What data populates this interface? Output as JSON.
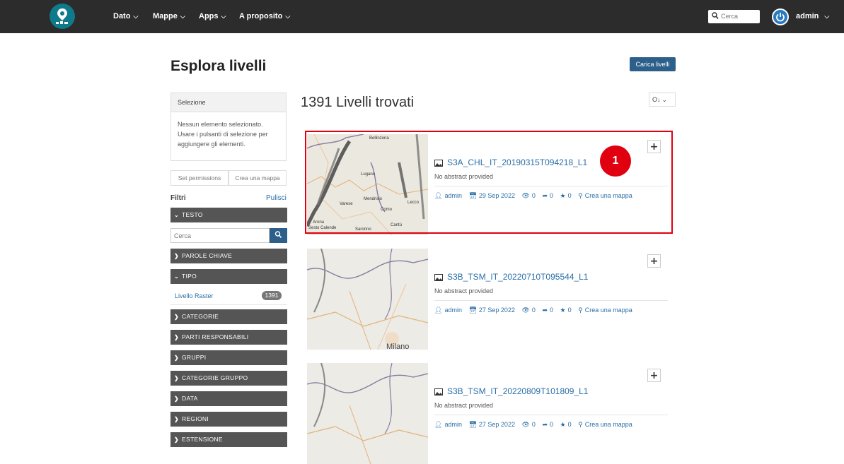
{
  "nav": {
    "items": [
      {
        "label": "Dato"
      },
      {
        "label": "Mappe"
      },
      {
        "label": "Apps"
      },
      {
        "label": "A proposito"
      }
    ],
    "search_placeholder": "Cerca",
    "user": "admin"
  },
  "page": {
    "title": "Esplora livelli",
    "upload_label": "Carica livelli"
  },
  "selection": {
    "header": "Selezione",
    "body": "Nessun elemento selezionato. Usare i pulsanti di selezione per aggiungere gli elementi.",
    "set_permissions": "Set permissions",
    "create_map": "Crea una mappa"
  },
  "filters": {
    "label": "Filtri",
    "clear": "Pulisci",
    "text_facet": "Testo",
    "text_placeholder": "Cerca",
    "keywords": "Parole chiave",
    "type": "Tipo",
    "type_option": "Livello Raster",
    "type_count": "1391",
    "categories": "Categorie",
    "responsible": "Parti responsabili",
    "groups": "Gruppi",
    "group_categories": "Categorie gruppo",
    "date": "Data",
    "regions": "Regioni",
    "extent": "Estensione"
  },
  "results": {
    "title": "1391 Livelli trovati",
    "sort": "O↓",
    "items": [
      {
        "title": "S3A_CHL_IT_20190315T094218_L1",
        "abstract": "No abstract provided",
        "owner": "admin",
        "date": "29 Sep 2022",
        "views": "0",
        "shares": "0",
        "rating": "0",
        "create_map": "Crea una mappa"
      },
      {
        "title": "S3B_TSM_IT_20220710T095544_L1",
        "abstract": "No abstract provided",
        "owner": "admin",
        "date": "27 Sep 2022",
        "views": "0",
        "shares": "0",
        "rating": "0",
        "create_map": "Crea una mappa"
      },
      {
        "title": "S3B_TSM_IT_20220809T101809_L1",
        "abstract": "No abstract provided",
        "owner": "admin",
        "date": "27 Sep 2022",
        "views": "0",
        "shares": "0",
        "rating": "0",
        "create_map": "Crea una mappa"
      }
    ],
    "add_label": "+"
  },
  "map_labels": {
    "a": [
      "Bellinzona",
      "Lugano",
      "Mendrisio",
      "Varese",
      "Como",
      "Lecco",
      "Cantù",
      "Arona",
      "Sesto Calende",
      "Saronno"
    ],
    "b": [
      "Milano"
    ]
  },
  "annotation": {
    "marker": "1"
  },
  "colors": {
    "topbar": "#2c2c2c",
    "accent": "#2c5f8a",
    "link": "#2a6fa8",
    "highlight": "#e0000f"
  }
}
